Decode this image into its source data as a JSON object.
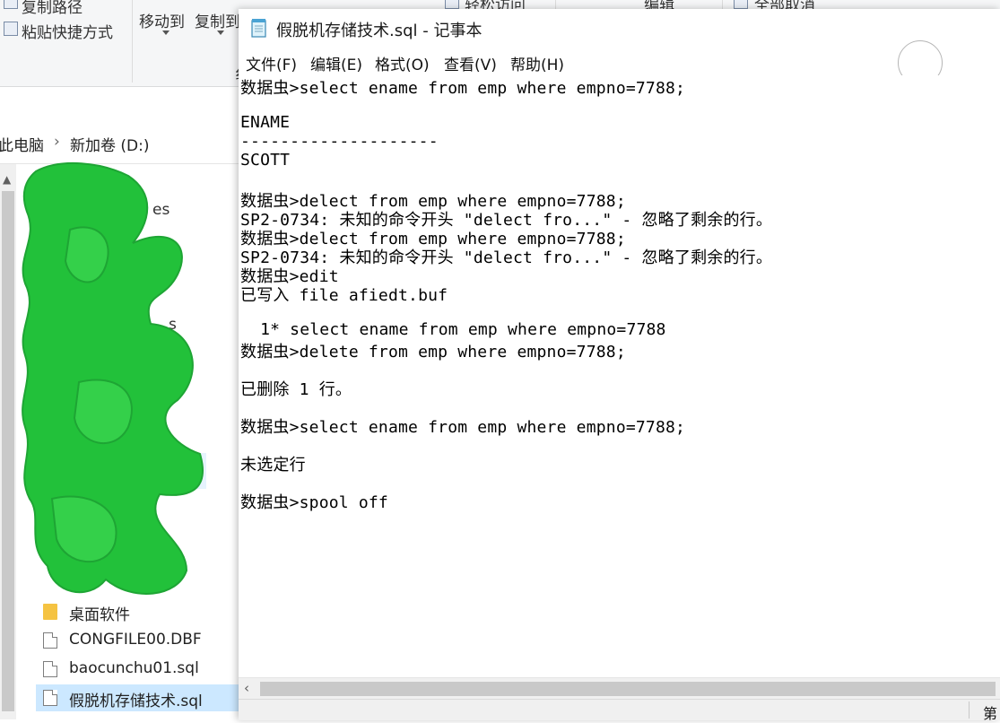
{
  "explorer": {
    "ribbon": {
      "copy_path": "复制路径",
      "paste_shortcut": "粘贴快捷方式",
      "move_to": "移动到",
      "copy_to": "复制到",
      "easy_access": "轻松访问",
      "edit": "编辑",
      "select_none": "全部取消",
      "group_label_fragment": "纟"
    },
    "breadcrumb": {
      "this_pc": "此电脑",
      "drive": "新加卷 (D:)"
    },
    "nav_partial_labels": [
      "es",
      "s"
    ],
    "nav_items": [
      {
        "label": "桌面软件",
        "icon": "folder-icon"
      },
      {
        "label": "CONGFILE00.DBF",
        "icon": "file-icon"
      },
      {
        "label": "baocunchu01.sql",
        "icon": "file-icon"
      },
      {
        "label": "假脱机存储技术.sql",
        "icon": "file-icon",
        "selected": true
      }
    ],
    "redaction_color": "#22c13a"
  },
  "notepad": {
    "title": "假脱机存储技术.sql - 记事本",
    "menu": [
      "文件(F)",
      "编辑(E)",
      "格式(O)",
      "查看(V)",
      "帮助(H)"
    ],
    "lines": [
      "数据虫>select ename from emp where empno=7788;",
      "",
      "ENAME",
      "--------------------",
      "SCOTT",
      "",
      "数据虫>delect from emp where empno=7788;",
      "SP2-0734: 未知的命令开头 \"delect fro...\" - 忽略了剩余的行。",
      "数据虫>delect from emp where empno=7788;",
      "SP2-0734: 未知的命令开头 \"delect fro...\" - 忽略了剩余的行。",
      "数据虫>edit",
      "已写入 file afiedt.buf",
      "",
      "  1* select ename from emp where empno=7788",
      "数据虫>delete from emp where empno=7788;",
      "",
      "已删除 1 行。",
      "",
      "数据虫>select ename from emp where empno=7788;",
      "",
      "未选定行",
      "",
      "数据虫>spool off"
    ],
    "status_text": "第"
  }
}
